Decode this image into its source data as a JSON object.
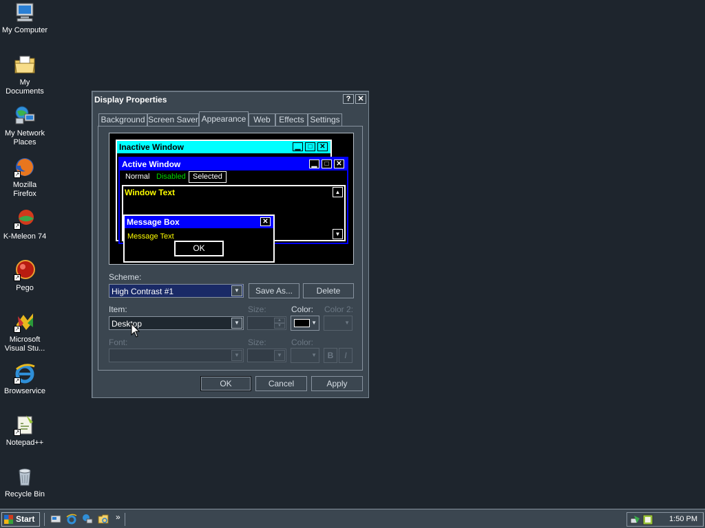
{
  "desktop": {
    "icons": [
      {
        "label": "My Computer",
        "icon": "computer-icon"
      },
      {
        "label": "My Documents",
        "icon": "folder-documents-icon"
      },
      {
        "label": "My Network Places",
        "icon": "network-icon"
      },
      {
        "label": "Mozilla Firefox",
        "icon": "firefox-icon"
      },
      {
        "label": "K-Meleon 74",
        "icon": "kmeleon-icon"
      },
      {
        "label": "Pego",
        "icon": "pego-icon"
      },
      {
        "label": "Microsoft Visual Stu...",
        "icon": "visual-studio-icon"
      },
      {
        "label": "Browservice",
        "icon": "internet-explorer-icon"
      },
      {
        "label": "Notepad++",
        "icon": "notepadpp-icon"
      },
      {
        "label": "Recycle Bin",
        "icon": "recycle-bin-icon"
      }
    ]
  },
  "dialog": {
    "title": "Display Properties",
    "help_btn": "?",
    "close_btn": "✕",
    "tabs": [
      "Background",
      "Screen Saver",
      "Appearance",
      "Web",
      "Effects",
      "Settings"
    ],
    "active_tab": "Appearance",
    "preview": {
      "inactive_title": "Inactive Window",
      "active_title": "Active Window",
      "menu_normal": "Normal",
      "menu_disabled": "Disabled",
      "menu_selected": "Selected",
      "window_text": "Window Text",
      "msgbox_title": "Message Box",
      "msgbox_text": "Message Text",
      "msgbox_ok": "OK",
      "colors": {
        "inactive_title_bg": "#00ffff",
        "active_title_bg": "#0000ff",
        "window_text": "#ffff00",
        "window_bg": "#000000"
      }
    },
    "scheme_label": "Scheme:",
    "scheme_value": "High Contrast #1",
    "save_as": "Save As...",
    "delete": "Delete",
    "item_label": "Item:",
    "item_value": "Desktop",
    "size_label": "Size:",
    "color_label": "Color:",
    "color2_label": "Color 2:",
    "font_label": "Font:",
    "font_size_label": "Size:",
    "font_color_label": "Color:",
    "bold_btn": "B",
    "italic_btn": "I",
    "ok": "OK",
    "cancel": "Cancel",
    "apply": "Apply"
  },
  "taskbar": {
    "start": "Start",
    "quicklaunch": [
      "show-desktop-icon",
      "internet-explorer-icon",
      "network-icon",
      "folder-icon"
    ],
    "overflow": "»",
    "clock": "1:50 PM"
  },
  "theme": {
    "desktop_bg": "#1e252d",
    "window_bg": "#3b4650",
    "highlight": "#1a2a66"
  }
}
